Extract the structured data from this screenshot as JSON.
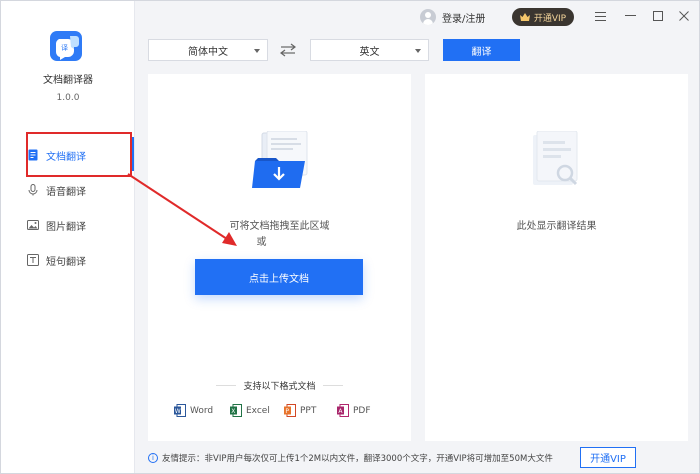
{
  "app": {
    "name": "文档翻译器",
    "version": "1.0.0"
  },
  "sidebar": {
    "items": [
      {
        "label": "文档翻译",
        "icon": "document-icon",
        "active": true
      },
      {
        "label": "语音翻译",
        "icon": "microphone-icon",
        "active": false
      },
      {
        "label": "图片翻译",
        "icon": "image-icon",
        "active": false
      },
      {
        "label": "短句翻译",
        "icon": "text-icon",
        "active": false
      }
    ]
  },
  "titlebar": {
    "login": "登录/注册",
    "vip": "开通VIP"
  },
  "toolbar": {
    "source_lang": "简体中文",
    "target_lang": "英文",
    "translate": "翻译"
  },
  "upload": {
    "hint_line1": "可将文档拖拽至此区域",
    "hint_line2": "或",
    "button": "点击上传文档",
    "formats_title": "支持以下格式文档",
    "formats": [
      "Word",
      "Excel",
      "PPT",
      "PDF"
    ]
  },
  "result": {
    "placeholder": "此处显示翻译结果"
  },
  "footer": {
    "tip": "友情提示：非VIP用户每次仅可上传1个2M以内文件，翻译3000个文字，开通VIP将可增加至50M大文件",
    "vip_button": "开通VIP"
  },
  "colors": {
    "accent": "#2170f4",
    "annotation": "#e02a2a"
  }
}
